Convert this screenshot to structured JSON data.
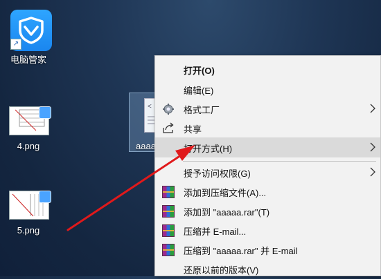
{
  "desktop": {
    "icons": [
      {
        "label": "电脑管家",
        "icon": "shield-check-icon"
      },
      {
        "label": "4.png",
        "icon": "image-file-icon"
      },
      {
        "label": "5.png",
        "icon": "image-file-icon"
      }
    ],
    "selected_file": {
      "label": "aaaa"
    }
  },
  "context_menu": {
    "items": [
      {
        "label": "打开(O)",
        "bold": true
      },
      {
        "label": "编辑(E)"
      },
      {
        "label": "格式工厂",
        "icon": "format-factory-icon",
        "submenu": true
      },
      {
        "label": "共享",
        "icon": "share-icon"
      },
      {
        "label": "打开方式(H)",
        "submenu": true,
        "highlighted": true
      },
      {
        "label": "授予访问权限(G)",
        "submenu": true
      },
      {
        "label": "添加到压缩文件(A)...",
        "icon": "winrar-icon"
      },
      {
        "label": "添加到 \"aaaaa.rar\"(T)",
        "icon": "winrar-icon"
      },
      {
        "label": "压缩并 E-mail...",
        "icon": "winrar-icon"
      },
      {
        "label": "压缩到 \"aaaaa.rar\" 并 E-mail",
        "icon": "winrar-icon"
      },
      {
        "label": "还原以前的版本(V)"
      }
    ]
  },
  "colors": {
    "annotation_arrow": "#e0191b",
    "menu_background": "#f2f2f2",
    "menu_highlight": "#dadada",
    "app_tile": "#1a86ef"
  }
}
